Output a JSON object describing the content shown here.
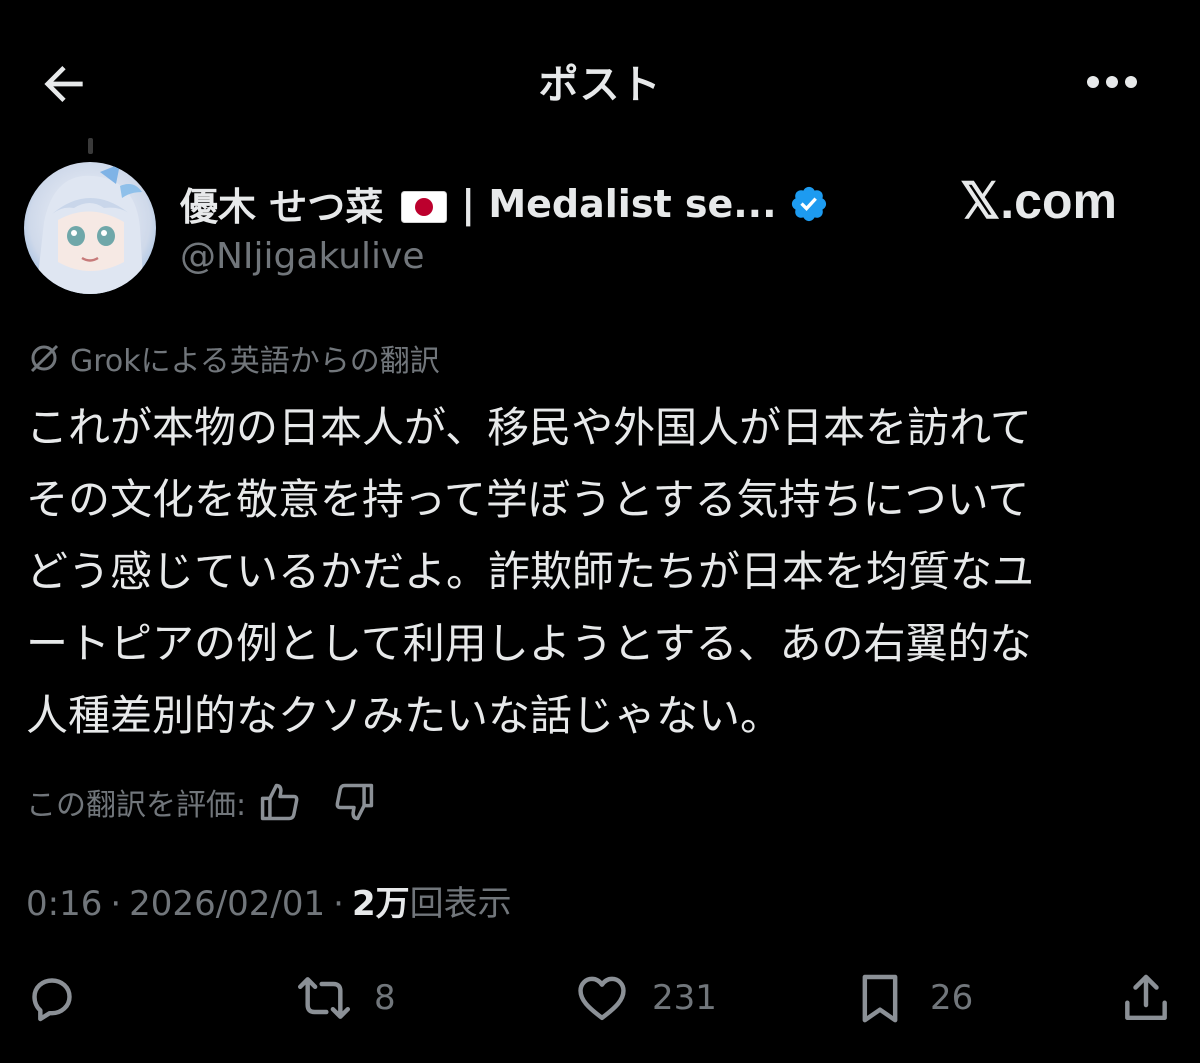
{
  "header": {
    "title": "ポスト",
    "back_icon": "arrow-left-icon",
    "more_icon": "more-horizontal-icon"
  },
  "author": {
    "name": "優木 せつ菜",
    "name_suffix": "| Medalist se...",
    "flag": "japan-flag",
    "verified": true,
    "handle": "@NIjigakulive"
  },
  "watermark": "𝕏.com",
  "translation": {
    "icon": "grok-icon",
    "notice": "Grokによる英語からの翻訳"
  },
  "post": {
    "lines": [
      "これが本物の日本人が、移民や外国人が日本を訪れて",
      "その文化を敬意を持って学ぼうとする気持ちについて",
      "どう感じているかだよ。詐欺師たちが日本を均質なユ",
      "ートピアの例として利用しようとする、あの右翼的な",
      "人種差別的なクソみたいな話じゃない。"
    ]
  },
  "rate": {
    "label": "この翻訳を評価:",
    "up_icon": "thumbs-up-icon",
    "down_icon": "thumbs-down-icon"
  },
  "meta": {
    "time": "0:16",
    "separator": "·",
    "date": "2026/02/01",
    "views_count": "2万",
    "views_label": "回表示"
  },
  "actions": {
    "reply": {
      "icon": "reply-icon",
      "count": ""
    },
    "repost": {
      "icon": "repost-icon",
      "count": "8"
    },
    "like": {
      "icon": "heart-icon",
      "count": "231"
    },
    "bookmark": {
      "icon": "bookmark-icon",
      "count": "26"
    },
    "share": {
      "icon": "share-icon",
      "count": ""
    }
  },
  "colors": {
    "background": "#000000",
    "text_primary": "#e7e9ea",
    "text_secondary": "#71767b",
    "verified_blue": "#1d9bf0",
    "flag_red": "#bc002d"
  }
}
